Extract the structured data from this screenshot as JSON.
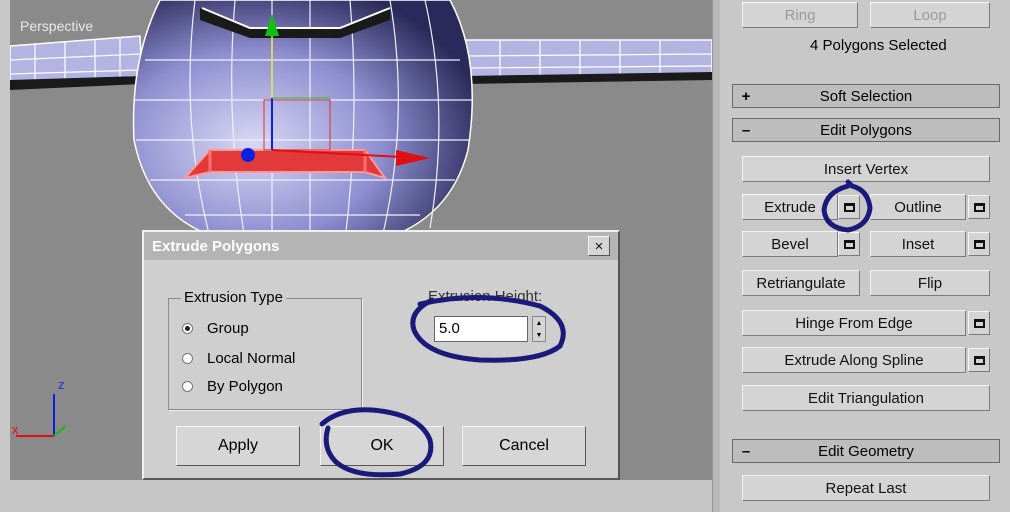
{
  "viewport": {
    "label": "Perspective"
  },
  "dialog": {
    "title": "Extrude Polygons",
    "close_label": "×",
    "extrusion_type": {
      "legend": "Extrusion Type",
      "options": [
        "Group",
        "Local Normal",
        "By Polygon"
      ],
      "selected": "Group"
    },
    "extrusion_height": {
      "label": "Extrusion Height:",
      "value": "5.0"
    },
    "buttons": {
      "apply": "Apply",
      "ok": "OK",
      "cancel": "Cancel"
    }
  },
  "panel": {
    "ring_label": "Ring",
    "loop_label": "Loop",
    "selection_info": "4 Polygons Selected",
    "soft_selection": {
      "sign": "+",
      "title": "Soft Selection"
    },
    "edit_polygons": {
      "sign": "–",
      "title": "Edit Polygons"
    },
    "buttons": {
      "insert_vertex": "Insert Vertex",
      "extrude": "Extrude",
      "outline": "Outline",
      "bevel": "Bevel",
      "inset": "Inset",
      "retriangulate": "Retriangulate",
      "flip": "Flip",
      "hinge_from_edge": "Hinge From Edge",
      "extrude_along_spline": "Extrude Along Spline",
      "edit_triangulation": "Edit Triangulation"
    },
    "edit_geometry": {
      "sign": "–",
      "title": "Edit Geometry"
    },
    "repeat_last": "Repeat Last"
  },
  "axis_labels": {
    "z": "z",
    "x": "x"
  },
  "colors": {
    "mesh": "#8c8ccc",
    "annotation": "#1a1a7a",
    "axis_red": "#e01010",
    "axis_green": "#10c010",
    "axis_blue": "#1020e0"
  }
}
